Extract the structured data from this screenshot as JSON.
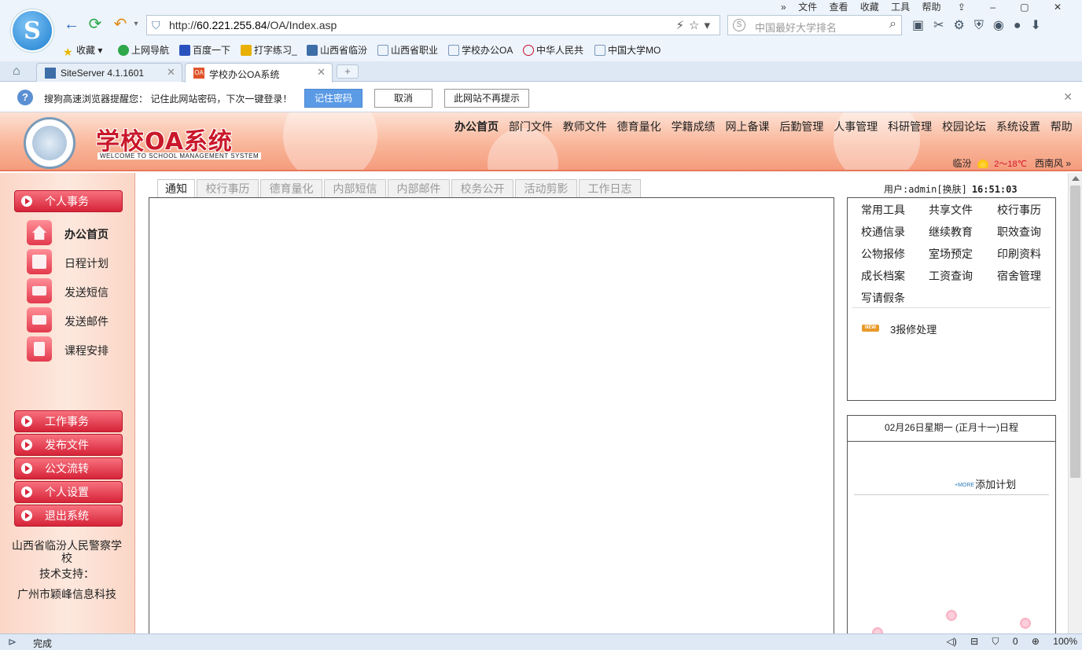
{
  "browser": {
    "url_prefix": "http://",
    "url_host": "60.221.255.84",
    "url_path": "/OA/Index.asp",
    "search_placeholder": "中国最好大学排名",
    "top_menu": [
      "»",
      "文件",
      "查看",
      "收藏",
      "工具",
      "帮助"
    ],
    "bookmarks_label": "收藏",
    "bookmarks": [
      "上网导航",
      "百度一下",
      "打字练习_",
      "山西省临汾",
      "山西省职业",
      "学校办公OA",
      "中华人民共",
      "中国大学MO"
    ],
    "tabs": [
      {
        "label": "SiteServer 4.1.1601",
        "active": false
      },
      {
        "label": "学校办公OA系统",
        "active": true
      }
    ],
    "new_tab": "+",
    "status": "完成",
    "zoom": "100%",
    "count_badge": "0"
  },
  "notify": {
    "message": "搜狗高速浏览器提醒您：  记住此网站密码，下次一键登录！",
    "remember": "记住密码",
    "cancel": "取消",
    "never": "此网站不再提示"
  },
  "header": {
    "title": "学校OA系统",
    "subtitle": "WELCOME TO SCHOOL MANAGEMENT SYSTEM",
    "nav": [
      "办公首页",
      "部门文件",
      "教师文件",
      "德育量化",
      "学籍成绩",
      "网上备课",
      "后勤管理",
      "人事管理",
      "科研管理",
      "校园论坛",
      "系统设置",
      "帮助"
    ],
    "weather_city": "临汾",
    "weather_temp": "2～18℃",
    "weather_wind": "西南风 »"
  },
  "sidebar": {
    "personal_head": "个人事务",
    "items": [
      "办公首页",
      "日程计划",
      "发送短信",
      "发送邮件",
      "课程安排"
    ],
    "sections": [
      "工作事务",
      "发布文件",
      "公文流转",
      "个人设置",
      "退出系统"
    ],
    "org_name": "山西省临汾人民警察学校",
    "support_label": "技术支持：",
    "support_company": "广州市颖峰信息科技"
  },
  "content_tabs": [
    "通知",
    "校行事历",
    "德育量化",
    "内部短信",
    "内部邮件",
    "校务公开",
    "活动剪影",
    "工作日志"
  ],
  "user_panel": {
    "user_text": "用户:admin[换肤]",
    "time": "16:51:03",
    "tools": [
      "常用工具",
      "共享文件",
      "校行事历",
      "校通信录",
      "继续教育",
      "职效查询",
      "公物报修",
      "室场预定",
      "印刷资料",
      "成长档案",
      "工资查询",
      "宿舍管理",
      "写请假条"
    ],
    "new_badge": "NEW",
    "repair_item": "3报修处理"
  },
  "schedule": {
    "title": "02月26日星期一 (正月十一)日程",
    "more_label": "+MORE",
    "add_plan": "添加计划"
  }
}
